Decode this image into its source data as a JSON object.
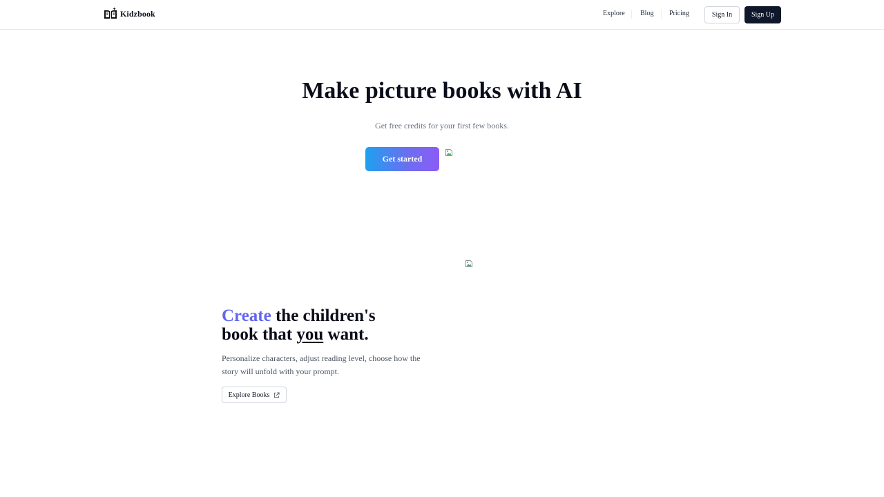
{
  "header": {
    "brand": "Kidzbook",
    "logo_icon": "book-icon",
    "nav": [
      {
        "label": "Explore"
      },
      {
        "label": "Blog"
      },
      {
        "label": "Pricing"
      }
    ],
    "sign_in_label": "Sign In",
    "sign_up_label": "Sign Up"
  },
  "hero": {
    "title": "Make picture books with AI",
    "subtitle": "Get free credits for your first few books.",
    "cta_label": "Get started",
    "cta_gradient": [
      "#1ea1ef",
      "#8b5cf6"
    ]
  },
  "feature": {
    "title_accent": "Create",
    "title_part1": " the children's",
    "title_part2": "book that ",
    "title_underlined": "you",
    "title_part3": " want.",
    "description": "Personalize characters, adjust reading level, choose how the story will unfold with your prompt.",
    "button_label": "Explore Books",
    "button_icon": "external-link-icon",
    "accent_color": "#6366f1"
  }
}
